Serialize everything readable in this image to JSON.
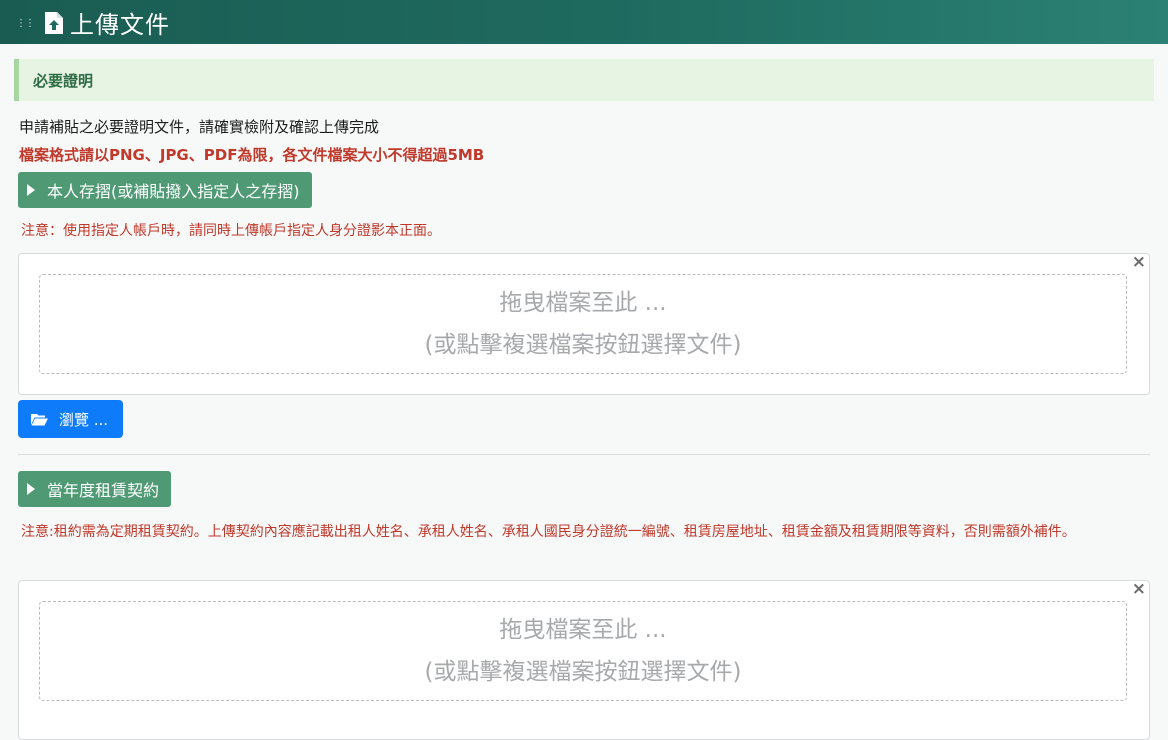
{
  "header": {
    "grip_icon": "grip-icon",
    "file_icon": "file-upload-icon",
    "title": "上傳文件"
  },
  "section": {
    "title": "必要證明"
  },
  "intro": {
    "description": "申請補貼之必要證明文件，請確實檢附及確認上傳完成",
    "format_note": "檔案格式請以PNG、JPG、PDF為限，各文件檔案大小不得超過5MB"
  },
  "groups": [
    {
      "button_label": "本人存摺(或補貼撥入指定人之存摺)",
      "note": "注意：使用指定人帳戶時，請同時上傳帳戶指定人身分證影本正面。",
      "dropzone": {
        "line1": "拖曳檔案至此 ...",
        "line2": "(或點擊複選檔案按鈕選擇文件)"
      },
      "close_label": "×",
      "browse_label": "瀏覽 ..."
    },
    {
      "button_label": "當年度租賃契約",
      "note": "注意:租約需為定期租賃契約。上傳契約內容應記載出租人姓名、承租人姓名、承租人國民身分證統一編號、租賃房屋地址、租賃金額及租賃期限等資料，否則需額外補件。",
      "dropzone": {
        "line1": "拖曳檔案至此 ...",
        "line2": "(或點擊複選檔案按鈕選擇文件)"
      },
      "close_label": "×"
    }
  ],
  "colors": {
    "header_start": "#1a5c52",
    "header_end": "#2b8174",
    "section_bg": "#e7f4e4",
    "green_button": "#4f9a75",
    "browse_button": "#0d7bfa",
    "warning_text": "#c0392b"
  }
}
